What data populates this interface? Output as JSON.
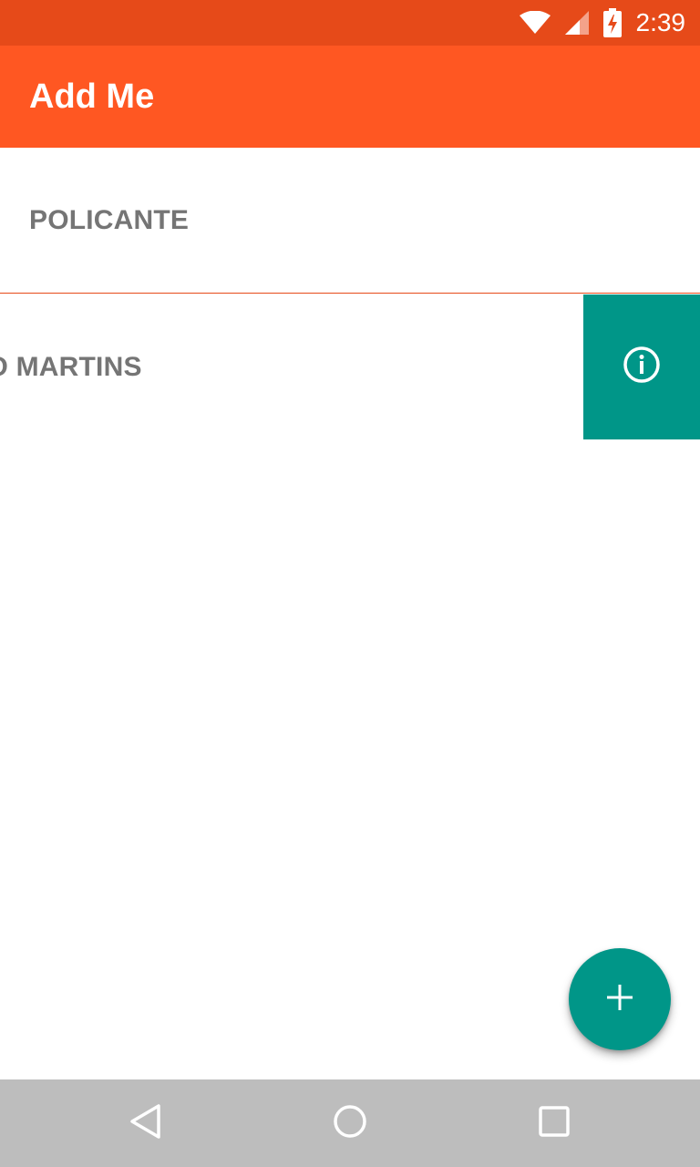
{
  "status_bar": {
    "time": "2:39",
    "icons": [
      "wifi-icon",
      "cell-signal-icon",
      "battery-charging-icon"
    ],
    "color": "#E64A19"
  },
  "app_bar": {
    "title": "Add Me",
    "color": "#FF5722"
  },
  "list": {
    "items": [
      {
        "label": "POLICANTE"
      },
      {
        "label": "GO MARTINS",
        "swipe_action": {
          "icon": "info-icon",
          "color": "#009688"
        }
      }
    ]
  },
  "fab": {
    "icon": "add-icon",
    "color": "#009688"
  },
  "nav_bar": {
    "buttons": [
      "back-icon",
      "home-icon",
      "recents-icon"
    ],
    "color": "#BDBDBD"
  }
}
